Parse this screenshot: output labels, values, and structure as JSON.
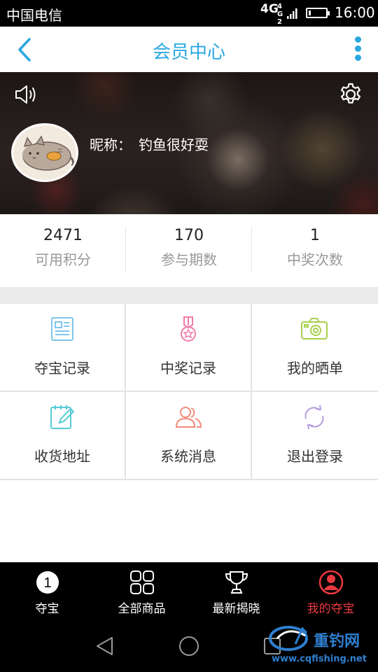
{
  "status_bar": {
    "carrier": "中国电信",
    "network": "4G",
    "network_small": "4G 2G",
    "time": "16:00",
    "battery_level": 0.15
  },
  "header": {
    "title": "会员中心",
    "back_icon": "chevron-left-icon",
    "more_icon": "vertical-dots-icon",
    "accent_color": "#2aa8e0"
  },
  "profile": {
    "nickname_label": "昵称：",
    "nickname": "钓鱼很好耍",
    "sound_icon": "speaker-icon",
    "settings_icon": "gear-icon"
  },
  "stats": [
    {
      "value": "2471",
      "label": "可用积分"
    },
    {
      "value": "170",
      "label": "参与期数"
    },
    {
      "value": "1",
      "label": "中奖次数"
    }
  ],
  "menu": [
    {
      "label": "夺宝记录",
      "icon": "document-icon",
      "color": "#7fc6ec"
    },
    {
      "label": "中奖记录",
      "icon": "medal-icon",
      "color": "#f07aa8"
    },
    {
      "label": "我的晒单",
      "icon": "camera-icon",
      "color": "#a7cf4a"
    },
    {
      "label": "收货地址",
      "icon": "edit-note-icon",
      "color": "#55cbd5"
    },
    {
      "label": "系统消息",
      "icon": "users-icon",
      "color": "#f08a7a"
    },
    {
      "label": "退出登录",
      "icon": "refresh-icon",
      "color": "#b59ee0"
    }
  ],
  "bottom_nav": [
    {
      "label": "夺宝",
      "icon": "number-one-icon",
      "badge": "1"
    },
    {
      "label": "全部商品",
      "icon": "grid-icon"
    },
    {
      "label": "最新揭晓",
      "icon": "trophy-icon"
    },
    {
      "label": "我的夺宝",
      "icon": "user-icon",
      "active": true,
      "color": "#e8393f"
    }
  ],
  "watermark": {
    "name": "重钓网",
    "url": "www.cqfishing.net"
  }
}
